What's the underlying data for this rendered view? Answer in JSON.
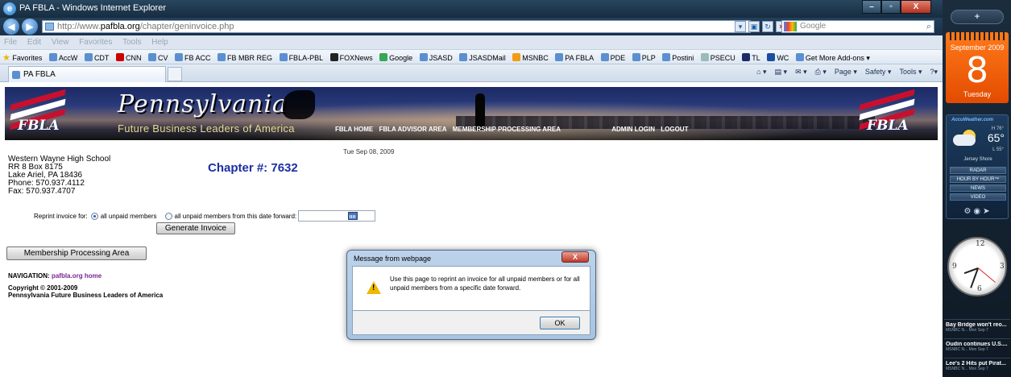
{
  "window": {
    "title": "PA FBLA - Windows Internet Explorer",
    "buttons": {
      "minimize": "–",
      "maximize": "▫",
      "close": "X"
    }
  },
  "address_bar": {
    "prefix": "http://www.",
    "domain": "pafbla.org",
    "path": "/chapter/geninvoice.php",
    "search_placeholder": "Google"
  },
  "menu": [
    "File",
    "Edit",
    "View",
    "Favorites",
    "Tools",
    "Help"
  ],
  "favorites": {
    "label": "Favorites",
    "items": [
      "AccW",
      "CDT",
      "CNN",
      "CV",
      "FB ACC",
      "FB MBR REG",
      "FBLA-PBL",
      "FOXNews",
      "Google",
      "JSASD",
      "JSASDMail",
      "MSNBC",
      "PA FBLA",
      "PDE",
      "PLP",
      "Postini",
      "PSECU",
      "TL",
      "WC",
      "Get More Add-ons ▾"
    ]
  },
  "tab": {
    "label": "PA FBLA"
  },
  "command_bar": [
    "Page ▾",
    "Safety ▾",
    "Tools ▾"
  ],
  "banner": {
    "state": "Pennsylvania",
    "tagline": "Future Business Leaders of America",
    "logo_text": "FBLA",
    "nav": [
      "FBLA HOME",
      "FBLA ADVISOR AREA",
      "MEMBERSHIP PROCESSING AREA"
    ],
    "nav_right": [
      "ADMIN LOGIN",
      "LOGOUT"
    ]
  },
  "page": {
    "date": "Tue Sep 08, 2009",
    "school": {
      "name": "Western Wayne High School",
      "address1": "RR 8 Box 8175",
      "address2": "Lake Ariel, PA  18436",
      "phone": "Phone: 570.937.4112",
      "fax": "Fax: 570.937.4707"
    },
    "chapter": "Chapter #: 7632",
    "reprint": {
      "label": "Reprint invoice for:",
      "option_all": "all unpaid members",
      "option_from_date": "all unpaid members from this date forward:",
      "selected": "all unpaid members",
      "date_value": ""
    },
    "generate_button": "Generate Invoice",
    "membership_button": "Membership Processing Area",
    "navigation_label": "NAVIGATION:",
    "navigation_link": "pafbla.org home",
    "copyright": "Copyright © 2001-2009",
    "org": "Pennsylvania Future Business Leaders of America"
  },
  "dialog": {
    "title": "Message from webpage",
    "message": "Use this page to reprint an invoice for all unpaid members or for all unpaid members from a specific date forward.",
    "ok": "OK",
    "close": "X"
  },
  "sidebar": {
    "top": "+",
    "calendar": {
      "month": "September 2009",
      "day": "8",
      "weekday": "Tuesday"
    },
    "weather": {
      "brand": "AccuWeather.com",
      "high": "H 76°",
      "temp": "65°",
      "low": "L 55°",
      "location": "Jersey Shore",
      "buttons": [
        "RADAR",
        "HOUR BY HOUR™",
        "NEWS",
        "VIDEO"
      ]
    },
    "news": [
      {
        "headline": "Bay Bridge won't reo...",
        "meta": "MSNBC N...   Mon Sep 7"
      },
      {
        "headline": "Oudin continues U.S....",
        "meta": "MSNBC N...   Mon Sep 7"
      },
      {
        "headline": "Lee's 2 Hits put Pirat...",
        "meta": "MSNBC N...   Mon Sep 7"
      }
    ]
  }
}
